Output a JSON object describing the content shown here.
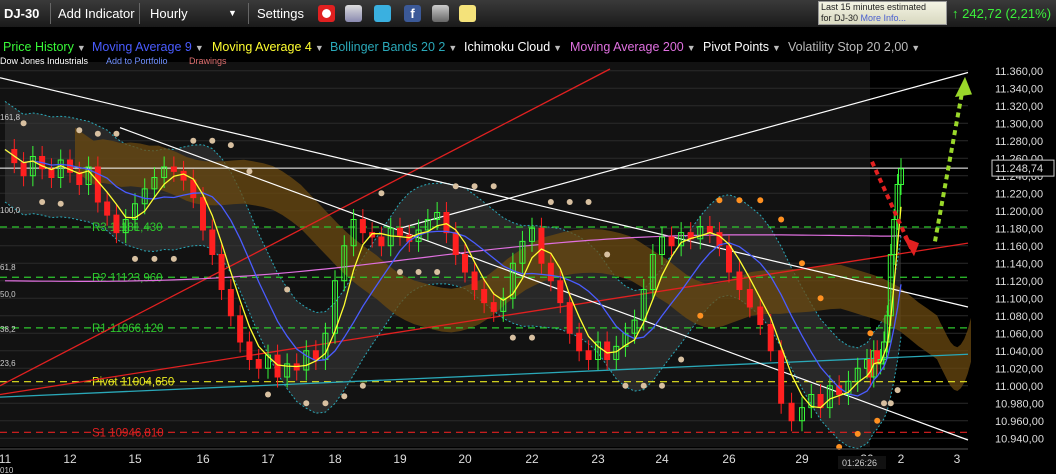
{
  "toolbar": {
    "symbol": "DJ-30",
    "add_indicator": "Add Indicator",
    "interval": "Hourly",
    "settings": "Settings",
    "notice_line1": "Last 15 minutes estimated",
    "notice_line2": "for DJ-30",
    "notice_more": "More Info...",
    "change": "242,72 (2,21%)"
  },
  "sub": {
    "instrument": "Dow Jones Industrials",
    "add_portfolio": "Add to Portfolio",
    "drawings": "Drawings"
  },
  "indicators": [
    {
      "label": "Price History",
      "color": "#38f838"
    },
    {
      "label": "Moving Average 9",
      "color": "#4a5cff"
    },
    {
      "label": "Moving Average 4",
      "color": "#ffff30"
    },
    {
      "label": "Bollinger Bands 20 2",
      "color": "#2aa8b8"
    },
    {
      "label": "Ichimoku Cloud",
      "color": "#ffffff"
    },
    {
      "label": "Moving Average 200",
      "color": "#e070e0"
    },
    {
      "label": "Pivot Points",
      "color": "#ffffff"
    },
    {
      "label": "Volatility Stop 20 2,00",
      "color": "#bbbbbb"
    }
  ],
  "chart_data": {
    "type": "candlestick",
    "y_ticks": [
      "11.360,00",
      "11.340,00",
      "11.320,00",
      "11.300,00",
      "11.280,00",
      "11.260,00",
      "11.240,00",
      "11.220,00",
      "11.200,00",
      "11.180,00",
      "11.160,00",
      "11.140,00",
      "11.120,00",
      "11.100,00",
      "11.080,00",
      "11.060,00",
      "11.040,00",
      "11.020,00",
      "11.000,00",
      "10.980,00",
      "10.960,00",
      "10.940,00"
    ],
    "ylim": [
      10930,
      11370
    ],
    "current_price_label": "11.248,74",
    "current_price": 11248.74,
    "x_ticks": [
      "11",
      "12",
      "15",
      "16",
      "17",
      "18",
      "19",
      "20",
      "22",
      "23",
      "24",
      "26",
      "29",
      "30",
      "2",
      "3"
    ],
    "x_tick_hours": [
      0,
      7,
      14,
      21,
      28,
      35,
      42,
      49,
      56,
      63,
      70,
      77,
      84,
      91,
      101,
      108
    ],
    "x_partial_label": "010",
    "time_label": "01:26:26",
    "left_labels": [
      "161,8",
      "100,0",
      "61,8",
      "50,0",
      "38,2",
      "23,6"
    ],
    "left_label_values": [
      11307,
      11201,
      11136,
      11105,
      11065,
      11026
    ],
    "pivots": [
      {
        "label": "R3 11181,430",
        "value": 11181.43,
        "color": "#2ec82e"
      },
      {
        "label": "R2 11123,960",
        "value": 11123.96,
        "color": "#2ec82e"
      },
      {
        "label": "R1 11066,120",
        "value": 11066.12,
        "color": "#2ec82e"
      },
      {
        "label": "Pivot 11004,650",
        "value": 11004.65,
        "color": "#e8e820"
      },
      {
        "label": "S1 10946,810",
        "value": 10946.81,
        "color": "#e02020"
      }
    ],
    "candle_closes": [
      11270,
      11255,
      11240,
      11262,
      11248,
      11238,
      11258,
      11244,
      11230,
      11250,
      11210,
      11195,
      11175,
      11190,
      11208,
      11225,
      11238,
      11250,
      11245,
      11235,
      11215,
      11178,
      11150,
      11110,
      11080,
      11050,
      11030,
      11020,
      11035,
      11010,
      11025,
      11018,
      11040,
      11030,
      11060,
      11120,
      11160,
      11190,
      11175,
      11170,
      11160,
      11180,
      11172,
      11165,
      11178,
      11190,
      11198,
      11175,
      11150,
      11130,
      11110,
      11095,
      11085,
      11100,
      11140,
      11165,
      11180,
      11140,
      11120,
      11095,
      11060,
      11040,
      11030,
      11050,
      11030,
      11045,
      11060,
      11075,
      11110,
      11150,
      11170,
      11160,
      11175,
      11168,
      11182,
      11175,
      11160,
      11130,
      11110,
      11090,
      11070,
      11040,
      10980,
      10960,
      10975,
      10990,
      10975,
      11000,
      10990,
      11005,
      11020,
      11030,
      11010,
      11040,
      11025,
      11030,
      11050,
      11080,
      11150,
      11190,
      11230,
      11248
    ]
  },
  "colors": {
    "up": "#38f838",
    "down": "#ff2020",
    "cloud": "#6b4a10",
    "band": "#444444"
  }
}
